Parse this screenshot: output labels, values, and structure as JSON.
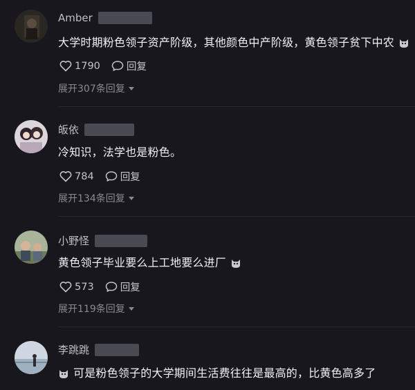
{
  "comments": [
    {
      "username": "Amber",
      "text": "大学时期粉色领子资产阶级，其他颜色中产阶级，黄色领子贫下中农",
      "likes": "1790",
      "reply_label": "回复",
      "expand": "展开307条回复"
    },
    {
      "username": "皈依",
      "text": "冷知识，法学也是粉色。",
      "likes": "784",
      "reply_label": "回复",
      "expand": "展开134条回复"
    },
    {
      "username": "小野怪",
      "text": "黄色领子毕业要么上工地要么进厂",
      "likes": "573",
      "reply_label": "回复",
      "expand": "展开119条回复"
    },
    {
      "username": "李跳跳",
      "text": "可是粉色领子的大学期间生活费往往是最高的，比黄色高多了"
    }
  ],
  "icons": {
    "like": "heart-icon",
    "reply": "speech-bubble-icon",
    "expand": "caret-down-icon",
    "emoji": "cat-emoji-icon"
  },
  "colors": {
    "background": "#17171d",
    "text": "#f1f1f5",
    "muted": "#8a8a92"
  }
}
